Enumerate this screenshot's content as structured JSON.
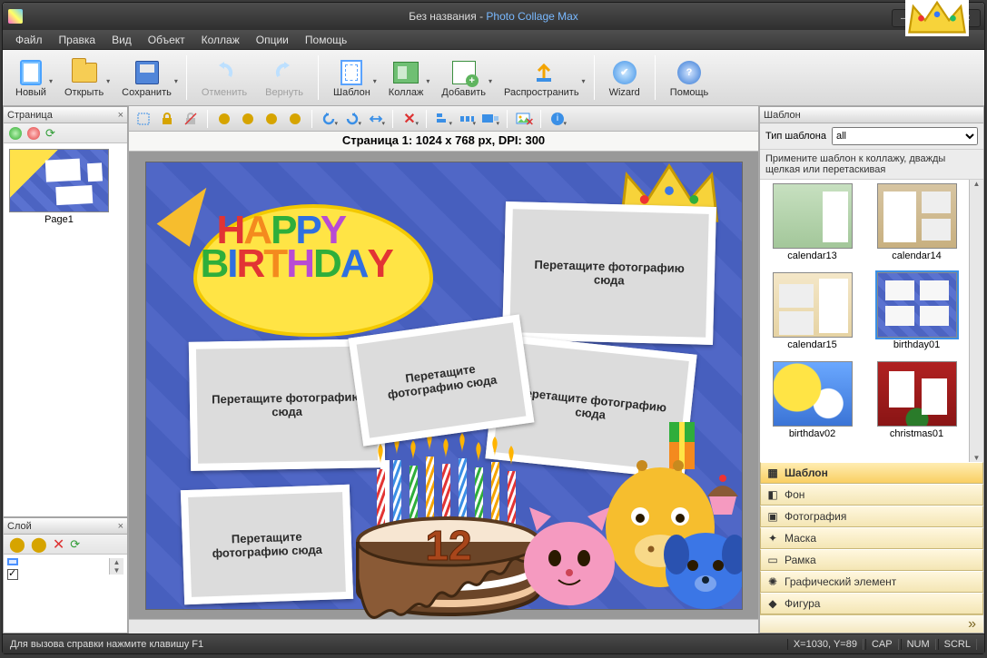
{
  "window": {
    "doc_title": "Без названия",
    "app_title": "Photo Collage Max"
  },
  "menu": [
    "Файл",
    "Правка",
    "Вид",
    "Объект",
    "Коллаж",
    "Опции",
    "Помощь"
  ],
  "toolbar": [
    {
      "key": "new",
      "label": "Новый",
      "icon": "doc",
      "dd": true
    },
    {
      "key": "open",
      "label": "Открыть",
      "icon": "open",
      "dd": true
    },
    {
      "key": "save",
      "label": "Сохранить",
      "icon": "save",
      "dd": true
    },
    {
      "sep": true
    },
    {
      "key": "undo",
      "label": "Отменить",
      "icon": "undo",
      "disabled": true
    },
    {
      "key": "redo",
      "label": "Вернуть",
      "icon": "redo",
      "disabled": true
    },
    {
      "sep": true
    },
    {
      "key": "template",
      "label": "Шаблон",
      "icon": "tpl",
      "dd": true
    },
    {
      "key": "collage",
      "label": "Коллаж",
      "icon": "collage",
      "dd": true
    },
    {
      "key": "add",
      "label": "Добавить",
      "icon": "add",
      "dd": true
    },
    {
      "key": "share",
      "label": "Распространить",
      "icon": "share",
      "dd": true
    },
    {
      "sep": true
    },
    {
      "key": "wizard",
      "label": "Wizard",
      "icon": "wiz"
    },
    {
      "sep": true
    },
    {
      "key": "help",
      "label": "Помощь",
      "icon": "help"
    }
  ],
  "left": {
    "page_panel_title": "Страница",
    "pages": [
      {
        "label": "Page1"
      }
    ],
    "layer_panel_title": "Слой"
  },
  "workspace": {
    "info": "Страница 1: 1024 x 768 px, DPI: 300",
    "placeholder": "Перетащите фотографию сюда"
  },
  "right": {
    "panel_title": "Шаблон",
    "type_label": "Тип шаблона",
    "type_value": "all",
    "hint": "Примените шаблон к коллажу, дважды щелкая или перетаскивая",
    "templates": [
      {
        "name": "calendar13",
        "cls": "cal"
      },
      {
        "name": "calendar14",
        "cls": "cal2"
      },
      {
        "name": "calendar15",
        "cls": "cal3"
      },
      {
        "name": "birthday01",
        "cls": "bday1",
        "selected": true
      },
      {
        "name": "birthdav02",
        "cls": "bday2"
      },
      {
        "name": "christmas01",
        "cls": "xmas"
      }
    ],
    "accordion": [
      {
        "label": "Шаблон",
        "icon": "▦",
        "active": true
      },
      {
        "label": "Фон",
        "icon": "◧"
      },
      {
        "label": "Фотография",
        "icon": "▣"
      },
      {
        "label": "Маска",
        "icon": "✦"
      },
      {
        "label": "Рамка",
        "icon": "▭"
      },
      {
        "label": "Графический элемент",
        "icon": "✺"
      },
      {
        "label": "Фигура",
        "icon": "◆"
      }
    ]
  },
  "status": {
    "hint": "Для вызова справки нажмите клавишу F1",
    "coords": "X=1030, Y=89",
    "ind": [
      "CAP",
      "NUM",
      "SCRL"
    ]
  }
}
